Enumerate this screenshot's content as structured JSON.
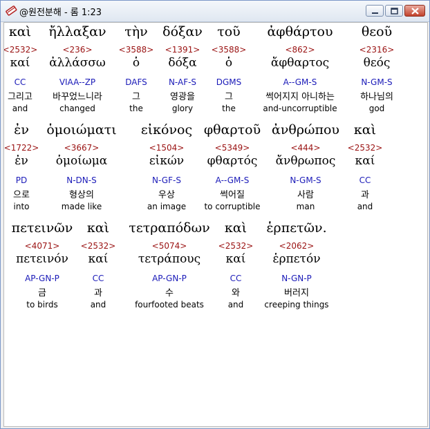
{
  "window": {
    "title": "@원전분해 - 롬 1:23"
  },
  "rows": [
    {
      "words": [
        {
          "greek": "καὶ",
          "strong": "<2532>",
          "lemma": "καί",
          "morph": "CC",
          "korean": "그리고",
          "english": "and"
        },
        {
          "greek": "ἤλλαξαν",
          "strong": "<236>",
          "lemma": "ἀλλάσσω",
          "morph": "VIAA--ZP",
          "korean": "바꾸었느니라",
          "english": "changed"
        },
        {
          "greek": "τὴν",
          "strong": "<3588>",
          "lemma": "ὁ",
          "morph": "DAFS",
          "korean": "그",
          "english": "the"
        },
        {
          "greek": "δόξαν",
          "strong": "<1391>",
          "lemma": "δόξα",
          "morph": "N-AF-S",
          "korean": "영광을",
          "english": "glory"
        },
        {
          "greek": "τοῦ",
          "strong": "<3588>",
          "lemma": "ὁ",
          "morph": "DGMS",
          "korean": "그",
          "english": "the"
        },
        {
          "greek": "ἀφθάρτου",
          "strong": "<862>",
          "lemma": "ἄφθαρτος",
          "morph": "A--GM-S",
          "korean": "썩어지지 아니하는",
          "english": "and-uncorruptible"
        },
        {
          "greek": "θεοῦ",
          "strong": "<2316>",
          "lemma": "θεός",
          "morph": "N-GM-S",
          "korean": "하나님의",
          "english": "god"
        }
      ]
    },
    {
      "words": [
        {
          "greek": "ἐν",
          "strong": "<1722>",
          "lemma": "ἐν",
          "morph": "PD",
          "korean": "으로",
          "english": "into"
        },
        {
          "greek": "ὁμοιώματι",
          "strong": "<3667>",
          "lemma": "ὁμοίωμα",
          "morph": "N-DN-S",
          "korean": "형상의",
          "english": "made like"
        },
        {
          "greek": "εἰκόνος",
          "strong": "<1504>",
          "lemma": "εἰκών",
          "morph": "N-GF-S",
          "korean": "우상",
          "english": "an image"
        },
        {
          "greek": "φθαρτοῦ",
          "strong": "<5349>",
          "lemma": "φθαρτός",
          "morph": "A--GM-S",
          "korean": "썩어질",
          "english": "to corruptible"
        },
        {
          "greek": "ἀνθρώπου",
          "strong": "<444>",
          "lemma": "ἄνθρωπος",
          "morph": "N-GM-S",
          "korean": "사람",
          "english": "man"
        },
        {
          "greek": "καὶ",
          "strong": "<2532>",
          "lemma": "καί",
          "morph": "CC",
          "korean": "과",
          "english": "and"
        }
      ]
    },
    {
      "words": [
        {
          "greek": "πετεινῶν",
          "strong": "<4071>",
          "lemma": "πετεινόν",
          "morph": "AP-GN-P",
          "korean": "금",
          "english": "to birds"
        },
        {
          "greek": "καὶ",
          "strong": "<2532>",
          "lemma": "καί",
          "morph": "CC",
          "korean": "과",
          "english": "and"
        },
        {
          "greek": "τετραπόδων",
          "strong": "<5074>",
          "lemma": "τετράπους",
          "morph": "AP-GN-P",
          "korean": "수",
          "english": "fourfooted beats"
        },
        {
          "greek": "καὶ",
          "strong": "<2532>",
          "lemma": "καί",
          "morph": "CC",
          "korean": "와",
          "english": "and"
        },
        {
          "greek": "ἑρπετῶν.",
          "strong": "<2062>",
          "lemma": "ἑρπετόν",
          "morph": "N-GN-P",
          "korean": "버러지",
          "english": "creeping things"
        }
      ]
    }
  ],
  "colors": {
    "strong": "#9a1212",
    "morph": "#1a1ab8",
    "text": "#000000",
    "client_bg": "#ffffff"
  }
}
